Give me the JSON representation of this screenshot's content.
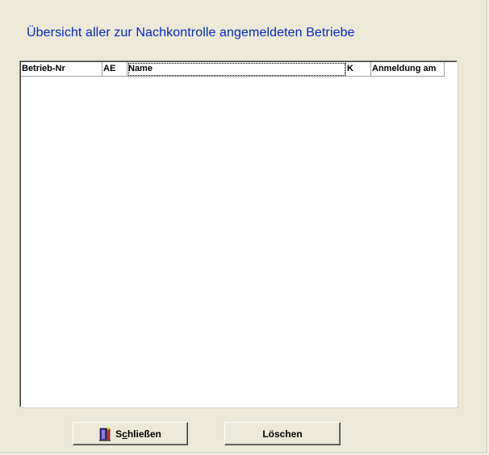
{
  "window": {
    "title": "Übersicht aller zur Nachkontrolle angemeldeten Betriebe"
  },
  "table": {
    "columns": [
      {
        "label": "Betrieb-Nr"
      },
      {
        "label": "AE"
      },
      {
        "label": "Name"
      },
      {
        "label": "K"
      },
      {
        "label": "Anmeldung am"
      }
    ],
    "rows": []
  },
  "buttons": {
    "close_label_prefix": "S",
    "close_label_mnemonic": "c",
    "close_label_rest": "hließen",
    "close_icon": "exit-door-icon",
    "delete_label": "Löschen"
  },
  "colors": {
    "title": "#0a24cc",
    "background": "#ece9d8"
  }
}
